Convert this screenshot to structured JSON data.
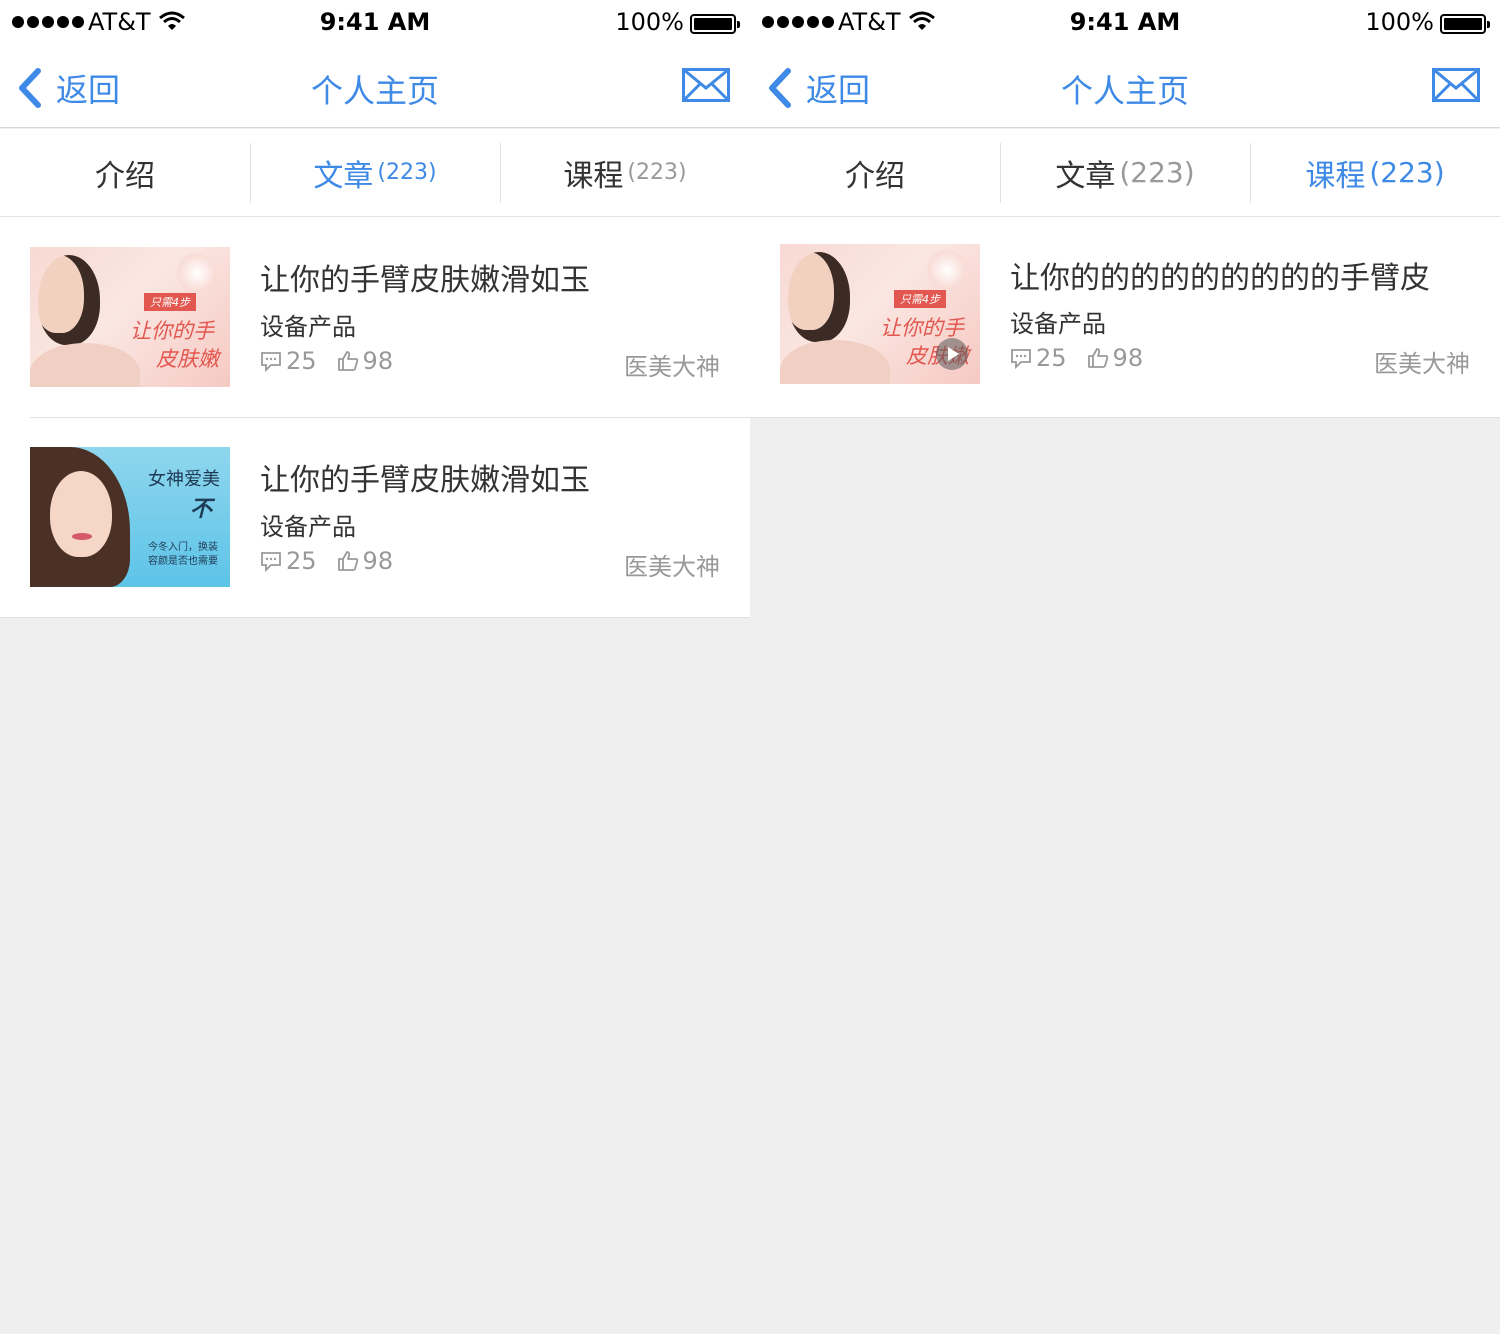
{
  "colors": {
    "accent": "#3e8ae6",
    "background": "#efefef",
    "meta": "#999999"
  },
  "screens": [
    {
      "status": {
        "carrier": "AT&T",
        "time": "9:41 AM",
        "battery": "100%"
      },
      "nav": {
        "back": "返回",
        "title": "个人主页",
        "mail_icon": "mail-icon"
      },
      "tabs": [
        {
          "label": "介绍",
          "count": ""
        },
        {
          "label": "文章",
          "count": "(223)"
        },
        {
          "label": "课程",
          "count": "(223)"
        }
      ],
      "active_tab": 1,
      "items": [
        {
          "title": "让你的手臂皮肤嫩滑如玉",
          "subtitle": "设备产品",
          "comments": "25",
          "likes": "98",
          "author": "医美大神",
          "thumb": {
            "tag": "只需4步",
            "line1": "让你的手",
            "line2": "皮肤嫩"
          }
        },
        {
          "title": "让你的手臂皮肤嫩滑如玉",
          "subtitle": "设备产品",
          "comments": "25",
          "likes": "98",
          "author": "医美大神",
          "thumb": {
            "line1": "女神爱美",
            "line2": "不",
            "line3": "今冬入门，换装",
            "line4": "容颜是否也需要"
          }
        }
      ]
    },
    {
      "status": {
        "carrier": "AT&T",
        "time": "9:41 AM",
        "battery": "100%"
      },
      "nav": {
        "back": "返回",
        "title": "个人主页",
        "mail_icon": "mail-icon"
      },
      "tabs": [
        {
          "label": "介绍",
          "count": ""
        },
        {
          "label": "文章",
          "count": "(223)"
        },
        {
          "label": "课程",
          "count": "(223)"
        }
      ],
      "active_tab": 2,
      "items": [
        {
          "title": "让你的的的的的的的的的手臂皮",
          "subtitle": "设备产品",
          "comments": "25",
          "likes": "98",
          "author": "医美大神",
          "thumb": {
            "tag": "只需4步",
            "line1": "让你的手",
            "line2": "皮肤嫩"
          }
        }
      ]
    }
  ]
}
